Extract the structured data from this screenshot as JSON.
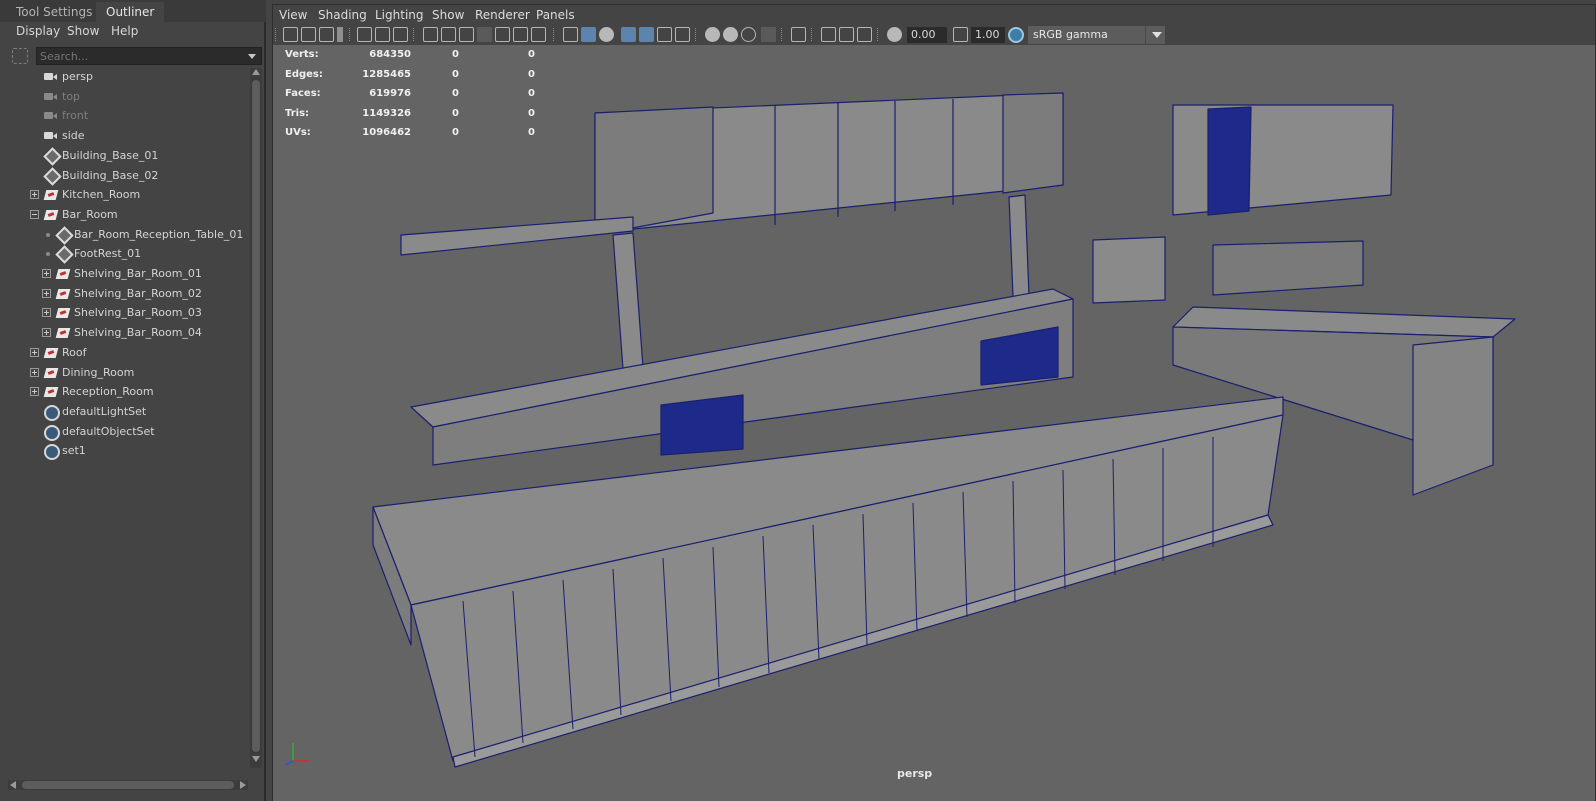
{
  "tabs": {
    "tool_settings": "Tool Settings",
    "outliner": "Outliner"
  },
  "outliner_menu": {
    "display": "Display",
    "show": "Show",
    "help": "Help"
  },
  "search": {
    "placeholder": "Search..."
  },
  "tree": [
    {
      "label": "persp",
      "icon": "camera-icon",
      "depth": 1,
      "dim": false
    },
    {
      "label": "top",
      "icon": "camera-icon",
      "depth": 1,
      "dim": true
    },
    {
      "label": "front",
      "icon": "camera-icon",
      "depth": 1,
      "dim": true
    },
    {
      "label": "side",
      "icon": "camera-icon",
      "depth": 1,
      "dim": false
    },
    {
      "label": "Building_Base_01",
      "icon": "mesh-icon",
      "depth": 1,
      "dim": false
    },
    {
      "label": "Building_Base_02",
      "icon": "mesh-icon",
      "depth": 1,
      "dim": false
    },
    {
      "label": "Kitchen_Room",
      "icon": "group-icon",
      "depth": 1,
      "expander": "plus"
    },
    {
      "label": "Bar_Room",
      "icon": "group-icon",
      "depth": 1,
      "expander": "minus"
    },
    {
      "label": "Bar_Room_Reception_Table_01",
      "icon": "mesh-icon",
      "depth": 2,
      "expander": "dot"
    },
    {
      "label": "FootRest_01",
      "icon": "mesh-icon",
      "depth": 2,
      "expander": "dot"
    },
    {
      "label": "Shelving_Bar_Room_01",
      "icon": "group-icon",
      "depth": 2,
      "expander": "plus"
    },
    {
      "label": "Shelving_Bar_Room_02",
      "icon": "group-icon",
      "depth": 2,
      "expander": "plus"
    },
    {
      "label": "Shelving_Bar_Room_03",
      "icon": "group-icon",
      "depth": 2,
      "expander": "plus"
    },
    {
      "label": "Shelving_Bar_Room_04",
      "icon": "group-icon",
      "depth": 2,
      "expander": "plus"
    },
    {
      "label": "Roof",
      "icon": "group-icon",
      "depth": 1,
      "expander": "plus"
    },
    {
      "label": "Dining_Room",
      "icon": "group-icon",
      "depth": 1,
      "expander": "plus"
    },
    {
      "label": "Reception_Room",
      "icon": "group-icon",
      "depth": 1,
      "expander": "plus"
    },
    {
      "label": "defaultLightSet",
      "icon": "set-icon",
      "depth": 1
    },
    {
      "label": "defaultObjectSet",
      "icon": "set-icon",
      "depth": 1
    },
    {
      "label": "set1",
      "icon": "set-icon",
      "depth": 1
    }
  ],
  "viewport_menu": {
    "view": "View",
    "shading": "Shading",
    "lighting": "Lighting",
    "show": "Show",
    "renderer": "Renderer",
    "panels": "Panels"
  },
  "toolbar": {
    "exposure": "0.00",
    "gamma": "1.00",
    "color_space": "sRGB gamma"
  },
  "hud": [
    {
      "label": "Verts:",
      "values": [
        "684350",
        "0",
        "0"
      ]
    },
    {
      "label": "Edges:",
      "values": [
        "1285465",
        "0",
        "0"
      ]
    },
    {
      "label": "Faces:",
      "values": [
        "619976",
        "0",
        "0"
      ]
    },
    {
      "label": "Tris:",
      "values": [
        "1149326",
        "0",
        "0"
      ]
    },
    {
      "label": "UVs:",
      "values": [
        "1096462",
        "0",
        "0"
      ]
    }
  ],
  "camera_label": "persp",
  "colors": {
    "viewport_bg": "#646464",
    "wire": "#1a1f6e",
    "mesh": "#8a8a8a",
    "panel_bg": "#444444",
    "highlight": "#5d84ad"
  }
}
